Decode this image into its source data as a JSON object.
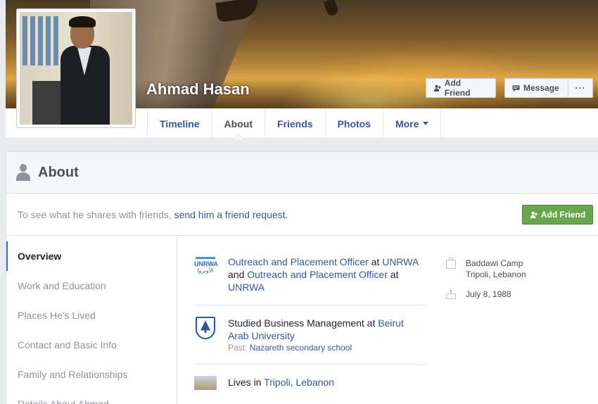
{
  "profile": {
    "name": "Ahmad Hasan"
  },
  "cover_actions": {
    "add_friend": "Add Friend",
    "message": "Message",
    "more": "···"
  },
  "nav": {
    "tabs": [
      {
        "label": "Timeline",
        "active": false
      },
      {
        "label": "About",
        "active": true
      },
      {
        "label": "Friends",
        "active": false
      },
      {
        "label": "Photos",
        "active": false
      },
      {
        "label": "More",
        "active": false
      }
    ]
  },
  "about": {
    "title": "About",
    "request_prefix": "To see what he shares with friends,",
    "request_link": "send him a friend request.",
    "add_friend_button": "Add Friend",
    "side_nav": [
      {
        "label": "Overview",
        "active": true
      },
      {
        "label": "Work and Education",
        "active": false
      },
      {
        "label": "Places He's Lived",
        "active": false
      },
      {
        "label": "Contact and Basic Info",
        "active": false
      },
      {
        "label": "Family and Relationships",
        "active": false
      },
      {
        "label": "Details About Ahmad",
        "active": false
      }
    ],
    "overview": {
      "work": {
        "icon": "unrwa-logo",
        "icon_text": "UNRWA",
        "icon_text_ar": "الأونروا",
        "job1": "Outreach and Placement Officer",
        "at1": "at",
        "org1": "UNRWA",
        "and": "and",
        "job2": "Outreach and Placement Officer",
        "at2": "at",
        "org2": "UNRWA"
      },
      "education": {
        "icon": "university-crest",
        "prefix": "Studied Business Management at",
        "school": "Beirut Arab University",
        "past_label": "Past:",
        "past_school": "Nazareth secondary school"
      },
      "lives": {
        "icon": "city-photo",
        "prefix": "Lives in",
        "place": "Tripoli, Lebanon"
      }
    },
    "facts": {
      "location_line1": "Baddawi Camp",
      "location_line2": "Tripoli, Lebanon",
      "birthday": "July 8, 1988"
    }
  },
  "colors": {
    "link": "#365899",
    "green_button": "#69a74e",
    "muted": "#90949c"
  }
}
